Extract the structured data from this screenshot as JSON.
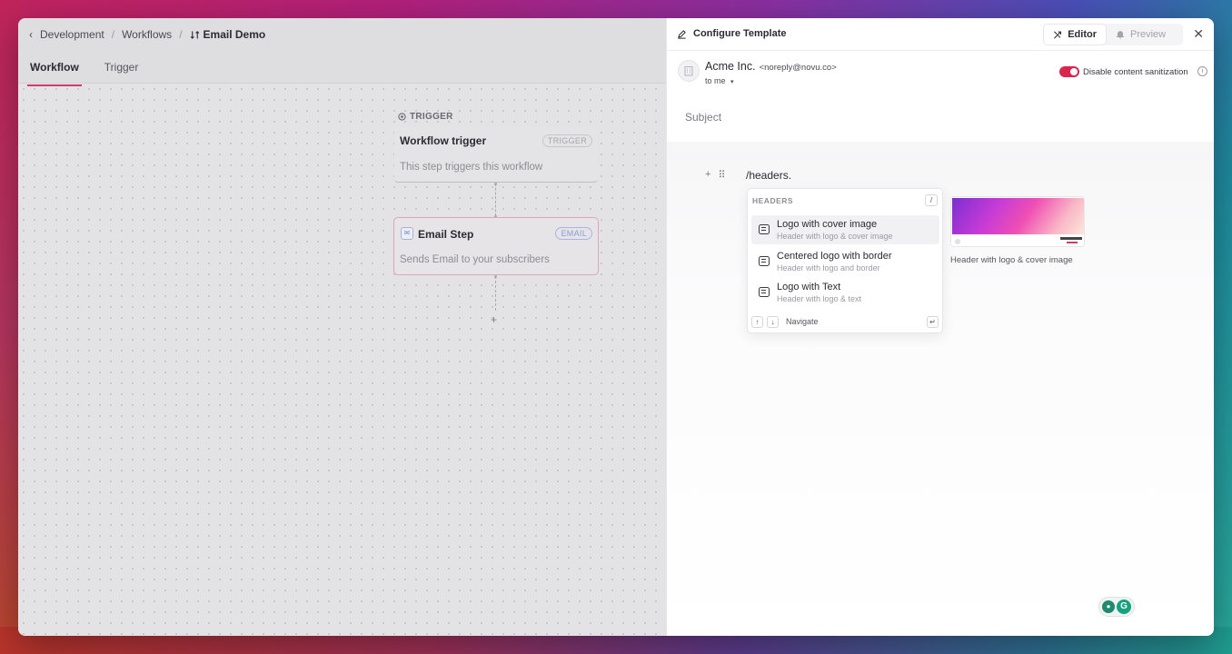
{
  "colors": {
    "accent": "#d23a6a",
    "toggle_on": "#d8264e",
    "email_badge": "#8b9bd8",
    "grammarly": "#15a27f"
  },
  "breadcrumb": {
    "items": [
      "Development",
      "Workflows"
    ],
    "current": "Email Demo"
  },
  "tabs": [
    {
      "label": "Workflow",
      "active": true
    },
    {
      "label": "Trigger",
      "active": false
    }
  ],
  "canvas": {
    "trigger_label": "TRIGGER",
    "trigger_node": {
      "title": "Workflow trigger",
      "badge": "TRIGGER",
      "description": "This step triggers this workflow"
    },
    "email_node": {
      "title": "Email Step",
      "badge": "EMAIL",
      "description": "Sends Email to your subscribers"
    },
    "add_step": "+"
  },
  "panel": {
    "title": "Configure Template",
    "editor_label": "Editor",
    "preview_label": "Preview",
    "close": "✕"
  },
  "sender": {
    "name": "Acme Inc.",
    "email": "<noreply@novu.co>",
    "to": "to me",
    "sanitization_label": "Disable content sanitization",
    "sanitization_enabled": true
  },
  "subject_placeholder": "Subject",
  "editor": {
    "text": "/headers.",
    "add": "+",
    "drag": "⠿"
  },
  "menu": {
    "heading": "HEADERS",
    "shortcut": "/",
    "items": [
      {
        "title": "Logo with cover image",
        "subtitle": "Header with logo & cover image",
        "active": true
      },
      {
        "title": "Centered logo with border",
        "subtitle": "Header with logo and border",
        "active": false
      },
      {
        "title": "Logo with Text",
        "subtitle": "Header with logo & text",
        "active": false
      }
    ],
    "footer": {
      "up": "↑",
      "down": "↓",
      "label": "Navigate",
      "enter": "↵"
    }
  },
  "preview": {
    "caption": "Header with logo & cover image"
  },
  "grammarly": {
    "logo": "G"
  }
}
